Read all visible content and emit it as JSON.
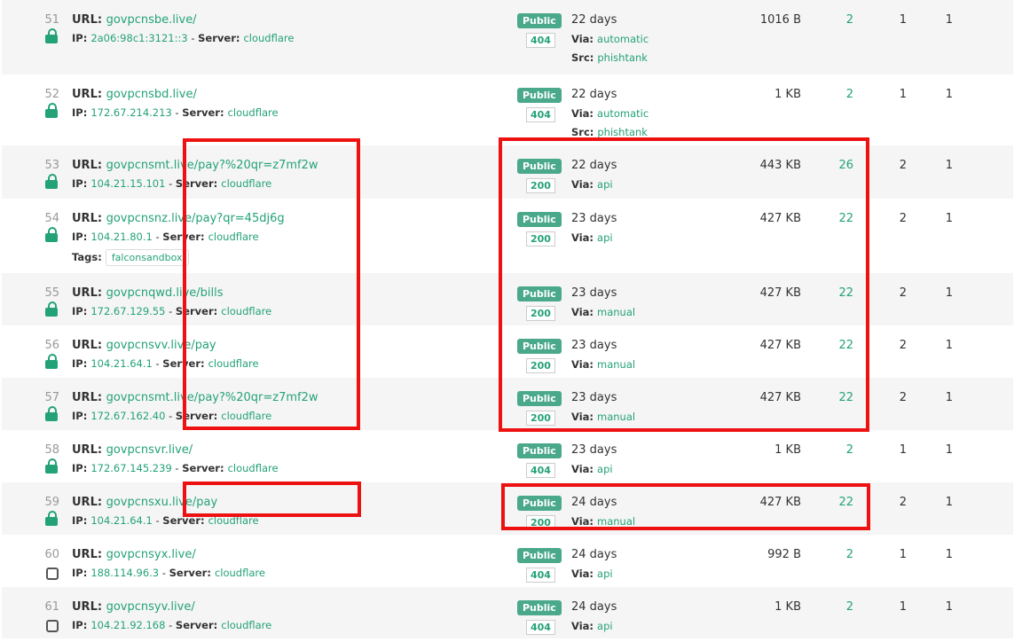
{
  "labels": {
    "url": "URL:",
    "ip": "IP:",
    "server": "Server:",
    "via": "Via:",
    "src": "Src:",
    "tags": "Tags:"
  },
  "rows": [
    {
      "num": "51",
      "url": "govpcnsbe.live/",
      "ip": "2a06:98c1:3121::3",
      "server": "cloudflare",
      "visibility": "Public",
      "status": "404",
      "age": "22 days",
      "via": "automatic",
      "src": "phishtank",
      "size": "1016 B",
      "c1": "2",
      "c2": "1",
      "c3": "1",
      "icon": "lock-icon",
      "tags": []
    },
    {
      "num": "52",
      "url": "govpcnsbd.live/",
      "ip": "172.67.214.213",
      "server": "cloudflare",
      "visibility": "Public",
      "status": "404",
      "age": "22 days",
      "via": "automatic",
      "src": "phishtank",
      "size": "1 KB",
      "c1": "2",
      "c2": "1",
      "c3": "1",
      "icon": "lock-icon",
      "tags": []
    },
    {
      "num": "53",
      "url": "govpcnsmt.live/pay?%20qr=z7mf2w",
      "ip": "104.21.15.101",
      "server": "cloudflare",
      "visibility": "Public",
      "status": "200",
      "age": "22 days",
      "via": "api",
      "src": "",
      "size": "443 KB",
      "c1": "26",
      "c2": "2",
      "c3": "1",
      "icon": "lock-icon",
      "tags": []
    },
    {
      "num": "54",
      "url": "govpcnsnz.live/pay?qr=45dj6g",
      "ip": "104.21.80.1",
      "server": "cloudflare",
      "visibility": "Public",
      "status": "200",
      "age": "23 days",
      "via": "api",
      "src": "",
      "size": "427 KB",
      "c1": "22",
      "c2": "2",
      "c3": "1",
      "icon": "lock-icon",
      "tags": [
        "falconsandbox"
      ]
    },
    {
      "num": "55",
      "url": "govpcnqwd.live/bills",
      "ip": "172.67.129.55",
      "server": "cloudflare",
      "visibility": "Public",
      "status": "200",
      "age": "23 days",
      "via": "manual",
      "src": "",
      "size": "427 KB",
      "c1": "22",
      "c2": "2",
      "c3": "1",
      "icon": "lock-icon",
      "tags": []
    },
    {
      "num": "56",
      "url": "govpcnsvv.live/pay",
      "ip": "104.21.64.1",
      "server": "cloudflare",
      "visibility": "Public",
      "status": "200",
      "age": "23 days",
      "via": "manual",
      "src": "",
      "size": "427 KB",
      "c1": "22",
      "c2": "2",
      "c3": "1",
      "icon": "lock-icon",
      "tags": []
    },
    {
      "num": "57",
      "url": "govpcnsmt.live/pay?%20qr=z7mf2w",
      "ip": "172.67.162.40",
      "server": "cloudflare",
      "visibility": "Public",
      "status": "200",
      "age": "23 days",
      "via": "manual",
      "src": "",
      "size": "427 KB",
      "c1": "22",
      "c2": "2",
      "c3": "1",
      "icon": "lock-icon",
      "tags": []
    },
    {
      "num": "58",
      "url": "govpcnsvr.live/",
      "ip": "172.67.145.239",
      "server": "cloudflare",
      "visibility": "Public",
      "status": "404",
      "age": "23 days",
      "via": "api",
      "src": "",
      "size": "1 KB",
      "c1": "2",
      "c2": "1",
      "c3": "1",
      "icon": "lock-icon",
      "tags": []
    },
    {
      "num": "59",
      "url": "govpcnsxu.live/pay",
      "ip": "104.21.64.1",
      "server": "cloudflare",
      "visibility": "Public",
      "status": "200",
      "age": "24 days",
      "via": "manual",
      "src": "",
      "size": "427 KB",
      "c1": "22",
      "c2": "2",
      "c3": "1",
      "icon": "lock-icon",
      "tags": []
    },
    {
      "num": "60",
      "url": "govpcnsyx.live/",
      "ip": "188.114.96.3",
      "server": "cloudflare",
      "visibility": "Public",
      "status": "404",
      "age": "24 days",
      "via": "api",
      "src": "",
      "size": "992 B",
      "c1": "2",
      "c2": "1",
      "c3": "1",
      "icon": "square-icon",
      "tags": []
    },
    {
      "num": "61",
      "url": "govpcnsyv.live/",
      "ip": "104.21.92.168",
      "server": "cloudflare",
      "visibility": "Public",
      "status": "404",
      "age": "24 days",
      "via": "api",
      "src": "",
      "size": "1 KB",
      "c1": "2",
      "c2": "1",
      "c3": "1",
      "icon": "square-icon",
      "tags": []
    }
  ],
  "colors": {
    "accent": "#24a277",
    "badge": "#4aa88b",
    "highlight": "#ee1111",
    "row_alt": "#f5f5f5"
  }
}
